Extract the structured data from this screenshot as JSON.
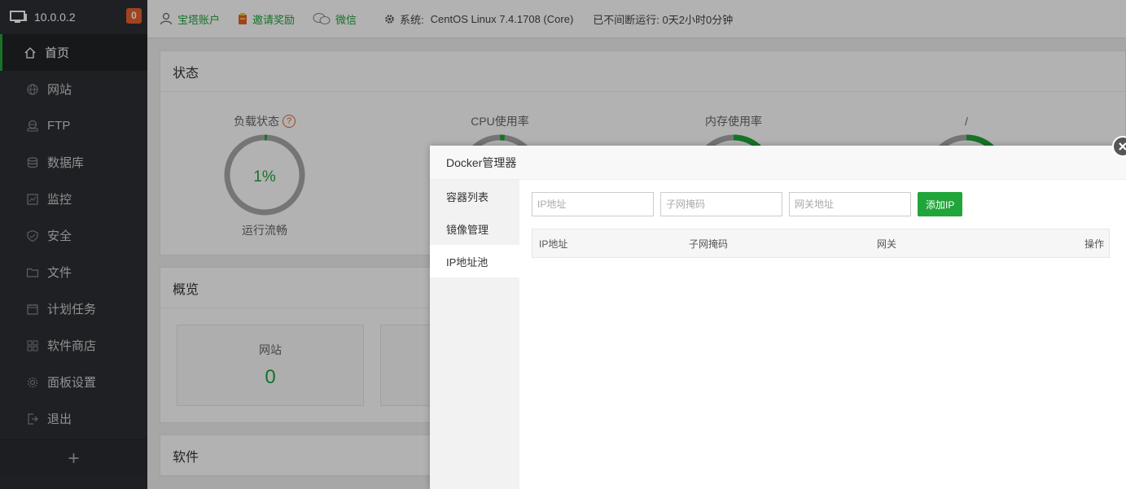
{
  "sidebar": {
    "server_label": "10.0.0.2",
    "badge_count": "0",
    "items": [
      {
        "label": "首页",
        "icon": "home-icon"
      },
      {
        "label": "网站",
        "icon": "globe-icon"
      },
      {
        "label": "FTP",
        "icon": "ftp-icon"
      },
      {
        "label": "数据库",
        "icon": "database-icon"
      },
      {
        "label": "监控",
        "icon": "monitor-icon"
      },
      {
        "label": "安全",
        "icon": "shield-icon"
      },
      {
        "label": "文件",
        "icon": "folder-icon"
      },
      {
        "label": "计划任务",
        "icon": "calendar-icon"
      },
      {
        "label": "软件商店",
        "icon": "grid-icon"
      },
      {
        "label": "面板设置",
        "icon": "gear-icon"
      },
      {
        "label": "退出",
        "icon": "logout-icon"
      }
    ],
    "add_label": "+"
  },
  "topbar": {
    "account_label": "宝塔账户",
    "invite_label": "邀请奖励",
    "wechat_label": "微信",
    "system_label": "系统:",
    "system_value": "CentOS Linux 7.4.1708 (Core)",
    "uptime": "已不间断运行: 0天2小时0分钟"
  },
  "status": {
    "title": "状态",
    "gauges": [
      {
        "title": "负载状态",
        "value": "1%",
        "percent": 1,
        "subtitle": "运行流畅",
        "help": "?"
      },
      {
        "title": "CPU使用率",
        "percent": 2
      },
      {
        "title": "内存使用率",
        "percent": 22
      },
      {
        "title": "/",
        "percent": 18
      }
    ]
  },
  "overview": {
    "title": "概览",
    "boxes": [
      {
        "label": "网站",
        "value": "0"
      }
    ]
  },
  "software": {
    "title": "软件"
  },
  "modal": {
    "title": "Docker管理器",
    "tabs": [
      "容器列表",
      "镜像管理",
      "IP地址池"
    ],
    "active_tab": 2,
    "inputs": {
      "ip_placeholder": "IP地址",
      "mask_placeholder": "子网掩码",
      "gateway_placeholder": "网关地址"
    },
    "add_button": "添加IP",
    "table_headers": [
      "IP地址",
      "子网掩码",
      "网关",
      "操作"
    ]
  },
  "colors": {
    "accent": "#20a53a",
    "badge": "#e8612c",
    "sidebar_bg": "#2c2e33"
  }
}
